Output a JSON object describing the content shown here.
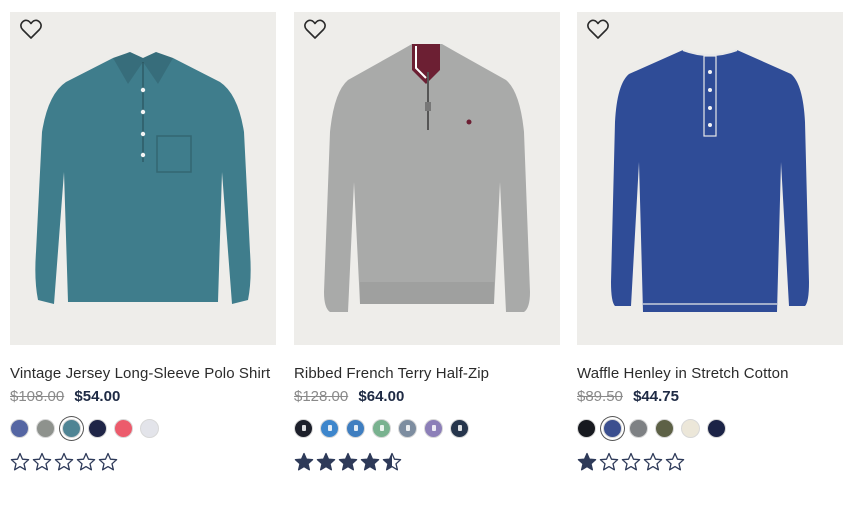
{
  "products": [
    {
      "name": "Vintage Jersey Long-Sleeve Polo Shirt",
      "original_price": "$108.00",
      "sale_price": "$54.00",
      "image_color": "#3f7d8c",
      "swatches": [
        {
          "color": "#5566a3",
          "selected": false
        },
        {
          "color": "#8e928d",
          "selected": false
        },
        {
          "color": "#4f8494",
          "selected": true
        },
        {
          "color": "#1f2547",
          "selected": false
        },
        {
          "color": "#ec5b6c",
          "selected": false
        },
        {
          "color": "#e3e4ea",
          "selected": false
        }
      ],
      "rating": 0
    },
    {
      "name": "Ribbed French Terry Half-Zip",
      "original_price": "$128.00",
      "sale_price": "$64.00",
      "image_color": "#a9aaa9",
      "swatches": [
        {
          "color": "#1c1f2a",
          "selected": false
        },
        {
          "color": "#3d86cc",
          "selected": false
        },
        {
          "color": "#3f7ec0",
          "selected": false
        },
        {
          "color": "#79b28f",
          "selected": false
        },
        {
          "color": "#7d8da0",
          "selected": false
        },
        {
          "color": "#8c7fb8",
          "selected": false
        },
        {
          "color": "#26354c",
          "selected": false
        }
      ],
      "rating": 4.5
    },
    {
      "name": "Waffle Henley in Stretch Cotton",
      "original_price": "$89.50",
      "sale_price": "$44.75",
      "image_color": "#2f4c97",
      "swatches": [
        {
          "color": "#17191f",
          "selected": false
        },
        {
          "color": "#3b4f8f",
          "selected": true
        },
        {
          "color": "#7e8184",
          "selected": false
        },
        {
          "color": "#5d6146",
          "selected": false
        },
        {
          "color": "#ece7d9",
          "selected": false
        },
        {
          "color": "#1b2346",
          "selected": false
        }
      ],
      "rating": 1
    }
  ],
  "colors": {
    "star_fill": "#2e3a59",
    "image_background": "#eeedea",
    "sale_price": "#1e2a44"
  }
}
